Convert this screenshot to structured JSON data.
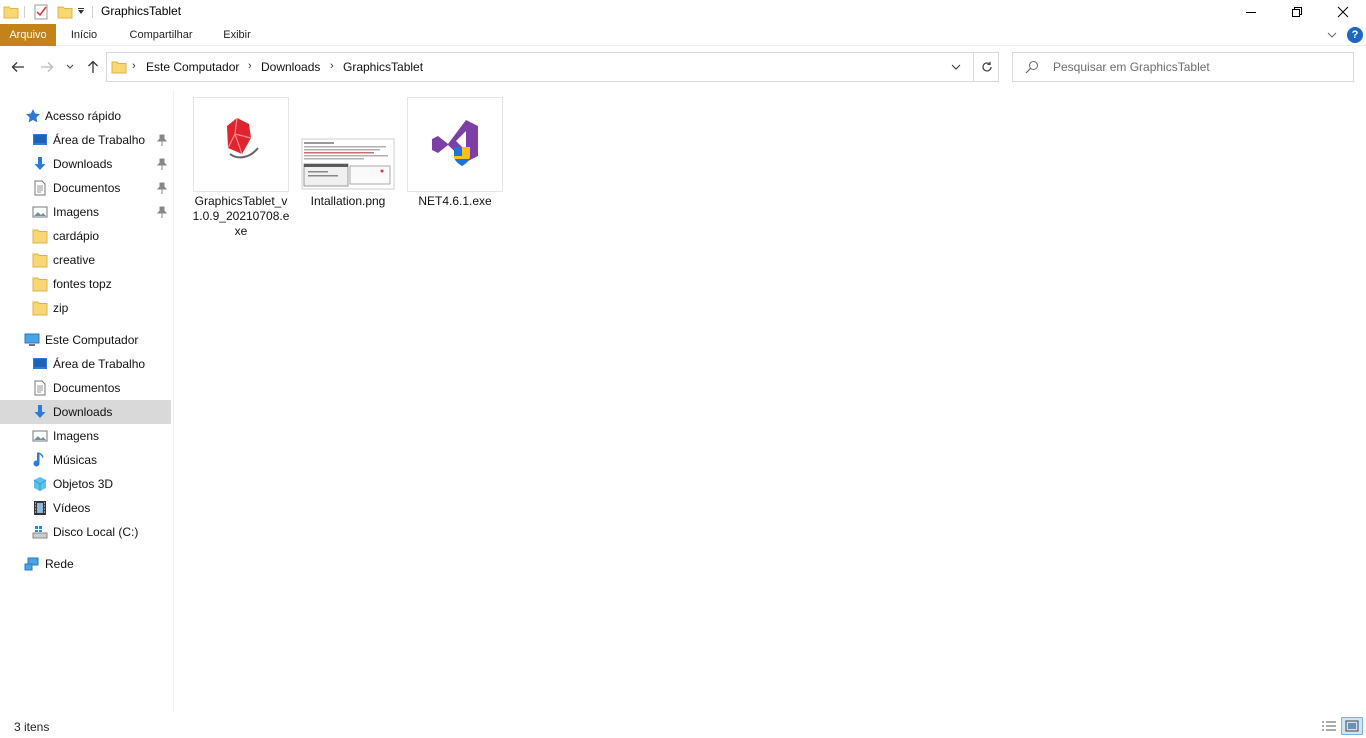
{
  "window": {
    "title": "GraphicsTablet"
  },
  "ribbon": {
    "tabs": [
      "Arquivo",
      "Início",
      "Compartilhar",
      "Exibir"
    ],
    "help_label": "?"
  },
  "address": {
    "crumbs": [
      "Este Computador",
      "Downloads",
      "GraphicsTablet"
    ]
  },
  "search": {
    "placeholder": "Pesquisar em GraphicsTablet"
  },
  "navpane": {
    "quick_access": {
      "label": "Acesso rápido",
      "items": [
        {
          "label": "Área de Trabalho",
          "icon": "desktop-icon",
          "pinned": true
        },
        {
          "label": "Downloads",
          "icon": "download-arrow-icon",
          "pinned": true
        },
        {
          "label": "Documentos",
          "icon": "document-icon",
          "pinned": true
        },
        {
          "label": "Imagens",
          "icon": "pictures-icon",
          "pinned": true
        },
        {
          "label": "cardápio",
          "icon": "folder-icon",
          "pinned": false
        },
        {
          "label": "creative",
          "icon": "folder-icon",
          "pinned": false
        },
        {
          "label": "fontes topz",
          "icon": "folder-icon",
          "pinned": false
        },
        {
          "label": "zip",
          "icon": "folder-icon",
          "pinned": false
        }
      ]
    },
    "this_pc": {
      "label": "Este Computador",
      "items": [
        {
          "label": "Área de Trabalho",
          "icon": "desktop-icon"
        },
        {
          "label": "Documentos",
          "icon": "document-icon"
        },
        {
          "label": "Downloads",
          "icon": "download-arrow-icon",
          "selected": true
        },
        {
          "label": "Imagens",
          "icon": "pictures-icon"
        },
        {
          "label": "Músicas",
          "icon": "music-note-icon"
        },
        {
          "label": "Objetos 3D",
          "icon": "cube-3d-icon"
        },
        {
          "label": "Vídeos",
          "icon": "film-icon"
        },
        {
          "label": "Disco Local (C:)",
          "icon": "drive-icon"
        }
      ]
    },
    "network": {
      "label": "Rede"
    }
  },
  "files": [
    {
      "name": "GraphicsTablet_v1.0.9_20210708.exe",
      "icon": "graphics-tablet-app-icon"
    },
    {
      "name": "Intallation.png",
      "icon": "image-thumbnail"
    },
    {
      "name": "NET4.6.1.exe",
      "icon": "visual-studio-shield-icon"
    }
  ],
  "status": {
    "item_count": "3 itens"
  },
  "colors": {
    "file_tab": "#c4831a",
    "selection": "#d9d9d9",
    "accent_blue": "#1d67c4",
    "folder_yellow": "#f8d775"
  }
}
